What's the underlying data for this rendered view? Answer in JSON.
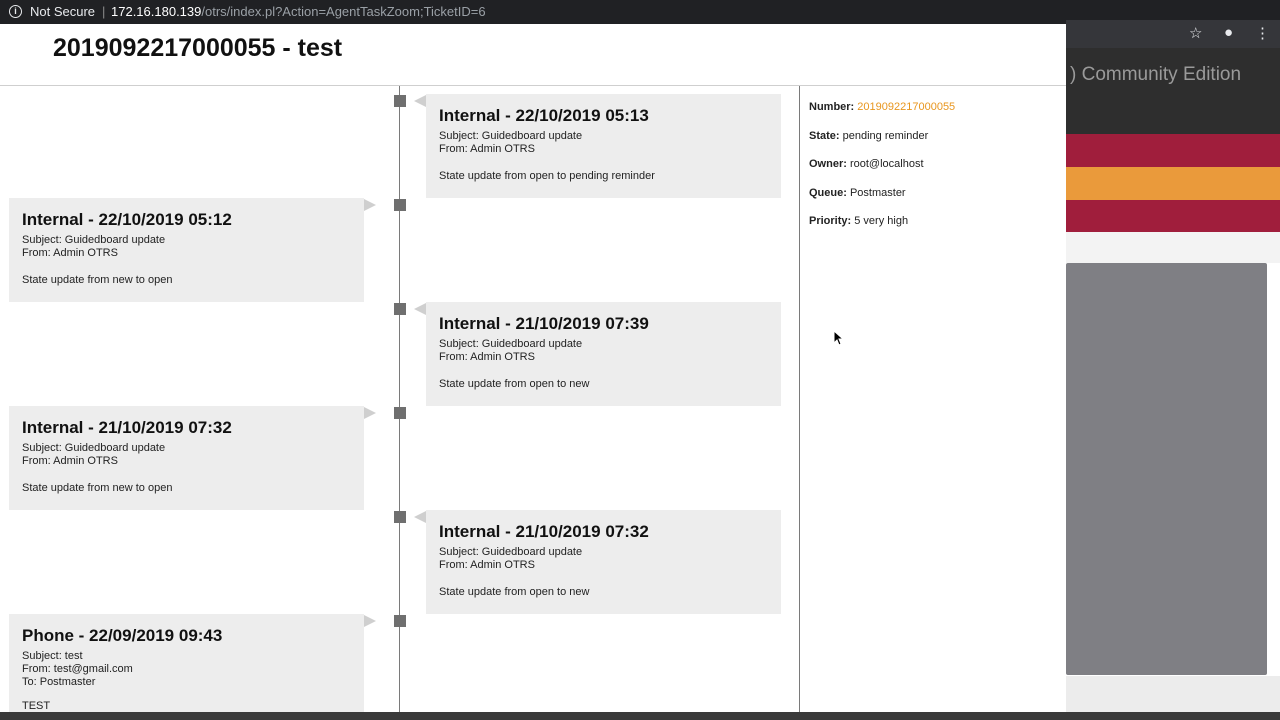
{
  "browser": {
    "security_label": "Not Secure",
    "url_host": "172.16.180.139",
    "url_path": "/otrs/index.pl?Action=AgentTaskZoom;TicketID=6"
  },
  "background_window": {
    "header_text": ") Community Edition",
    "stripe_colors": [
      "#a01e3c",
      "#ea9a3b",
      "#a01e3c"
    ],
    "icons": [
      "star-icon",
      "account-icon",
      "more-vert-icon"
    ]
  },
  "ticket": {
    "title": "2019092217000055 - test"
  },
  "timeline": {
    "items": [
      {
        "side": "right",
        "title": "Internal - 22/10/2019 05:13",
        "subject": "Subject: Guidedboard update",
        "from": "From: Admin OTRS",
        "to": "",
        "body": "State update from open to pending reminder"
      },
      {
        "side": "left",
        "title": "Internal - 22/10/2019 05:12",
        "subject": "Subject: Guidedboard update",
        "from": "From: Admin OTRS",
        "to": "",
        "body": "State update from new to open"
      },
      {
        "side": "right",
        "title": "Internal - 21/10/2019 07:39",
        "subject": "Subject: Guidedboard update",
        "from": "From: Admin OTRS",
        "to": "",
        "body": "State update from open to new"
      },
      {
        "side": "left",
        "title": "Internal - 21/10/2019 07:32",
        "subject": "Subject: Guidedboard update",
        "from": "From: Admin OTRS",
        "to": "",
        "body": "State update from new to open"
      },
      {
        "side": "right",
        "title": "Internal - 21/10/2019 07:32",
        "subject": "Subject: Guidedboard update",
        "from": "From: Admin OTRS",
        "to": "",
        "body": "State update from open to new"
      },
      {
        "side": "left",
        "title": "Phone - 22/09/2019 09:43",
        "subject": "Subject: test",
        "from": "From: test@gmail.com",
        "to": "To: Postmaster",
        "body": "TEST"
      }
    ]
  },
  "details": {
    "number_label": "Number:",
    "number_value": "2019092217000055",
    "state_label": "State:",
    "state_value": "pending reminder",
    "owner_label": "Owner:",
    "owner_value": "root@localhost",
    "queue_label": "Queue:",
    "queue_value": "Postmaster",
    "priority_label": "Priority:",
    "priority_value": "5 very high"
  },
  "colors": {
    "accent": "#e8961e",
    "card_bg": "#ededed"
  }
}
